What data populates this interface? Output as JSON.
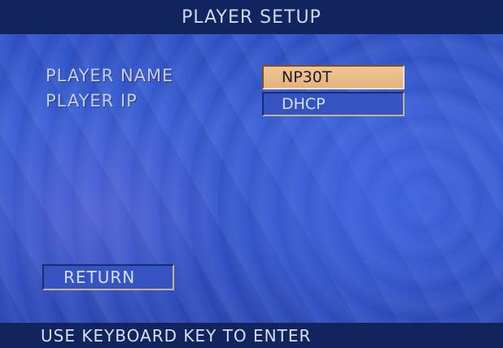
{
  "header": {
    "title": "PLAYER SETUP"
  },
  "settings": [
    {
      "label": "PLAYER NAME",
      "value": "NP30T",
      "selected": true
    },
    {
      "label": "PLAYER IP",
      "value": "DHCP",
      "selected": false
    }
  ],
  "return_label": "RETURN",
  "footer": {
    "hint": "USE KEYBOARD KEY TO ENTER"
  },
  "colors": {
    "bar_background": "#12245e",
    "screen_background": "#3457cc",
    "selected_field": "#e8b884",
    "text": "#c6cfe8"
  }
}
